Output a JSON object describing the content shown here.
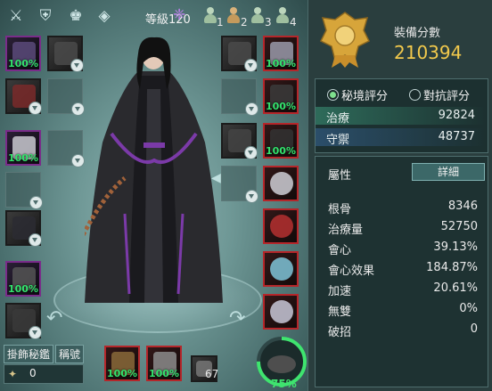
{
  "header": {
    "level": "等級120",
    "groups": [
      "1",
      "2",
      "3",
      "4"
    ]
  },
  "equipment": {
    "left_slots": [
      "100%",
      "",
      "100%",
      "",
      "",
      "100%",
      ""
    ],
    "right_slots": [
      "",
      "100%",
      "",
      "100%",
      "",
      "100%",
      "",
      "",
      "",
      ""
    ],
    "bottom_slots": [
      "100%",
      "100%"
    ],
    "misc_count": "67",
    "gauge": "75%"
  },
  "bottom_left": {
    "buttons": [
      "掛飾秘鑑",
      "稱號"
    ],
    "count": "0"
  },
  "score": {
    "label": "裝備分數",
    "value": "210394"
  },
  "evaluation": {
    "tabs": [
      "秘境評分",
      "對抗評分"
    ],
    "rows": [
      {
        "label": "治療",
        "value": "92824"
      },
      {
        "label": "守禦",
        "value": "48737"
      }
    ]
  },
  "attributes": {
    "title": "屬性",
    "detail_button": "詳細",
    "rows": [
      {
        "label": "根骨",
        "value": "8346"
      },
      {
        "label": "治療量",
        "value": "52750"
      },
      {
        "label": "會心",
        "value": "39.13%"
      },
      {
        "label": "會心效果",
        "value": "184.87%"
      },
      {
        "label": "加速",
        "value": "20.61%"
      },
      {
        "label": "無雙",
        "value": "0%"
      },
      {
        "label": "破招",
        "value": "0"
      }
    ]
  },
  "colors": {
    "accent_green": "#33e36d",
    "score_gold": "#f2c94c",
    "slot_purple": "#7a2c8a",
    "slot_red": "#b5262a"
  }
}
